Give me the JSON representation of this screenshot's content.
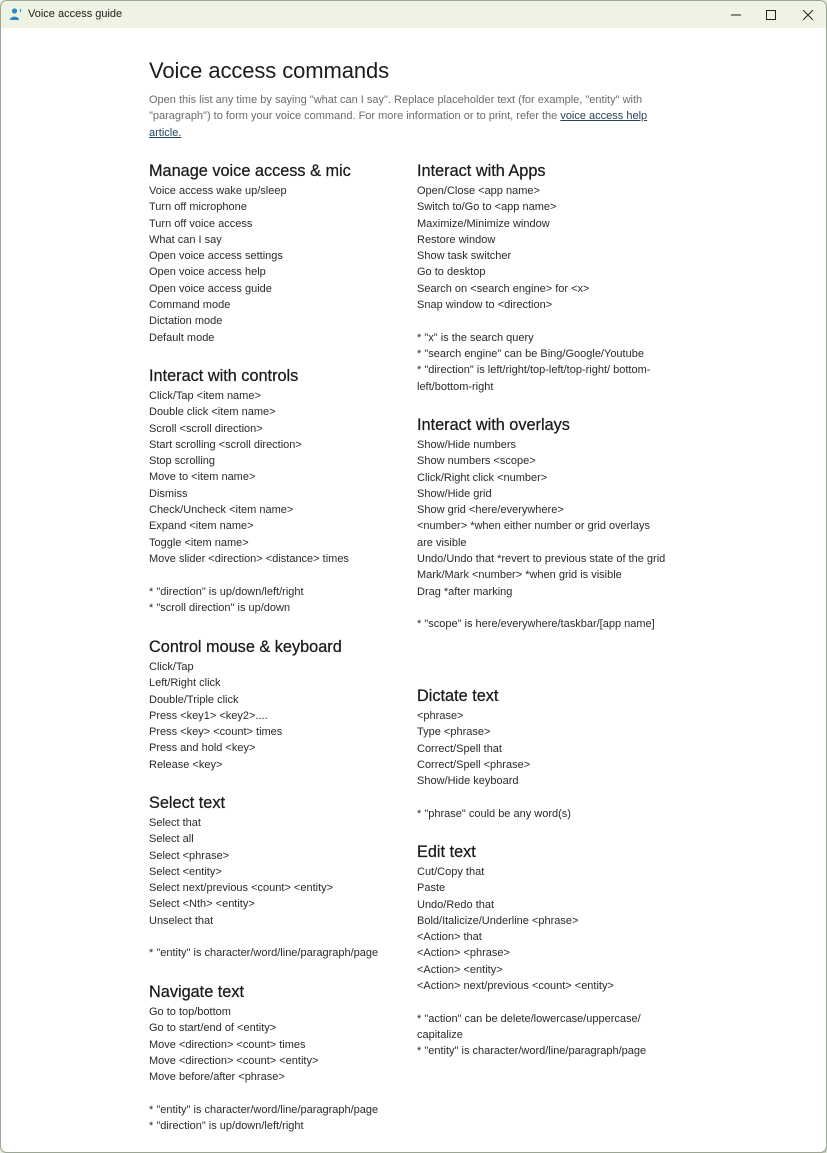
{
  "window": {
    "title": "Voice access guide",
    "controls": {
      "minimize": "minimize",
      "maximize": "maximize",
      "close": "close"
    },
    "accent_color": "#2b88c8"
  },
  "page": {
    "title": "Voice access commands",
    "intro_text": "Open this list any time by saying \"what can I say\". Replace placeholder text (for example, \"entity\" with \"paragraph\") to form your voice command. For more information or to print, refer the ",
    "help_link": "voice access help article."
  },
  "left_column": [
    {
      "heading": "Manage voice access & mic",
      "items": [
        "Voice access wake up/sleep",
        "Turn off microphone",
        "Turn off voice access",
        "What can I say",
        "Open voice access settings",
        "Open voice access help",
        "Open voice access guide",
        "Command mode",
        "Dictation mode",
        "Default mode"
      ],
      "notes": []
    },
    {
      "heading": "Interact with controls",
      "items": [
        "Click/Tap <item name>",
        "Double click <item name>",
        "Scroll <scroll direction>",
        "Start scrolling <scroll direction>",
        "Stop scrolling",
        "Move to <item name>",
        "Dismiss",
        "Check/Uncheck <item name>",
        "Expand <item name>",
        "Toggle <item name>",
        "Move slider <direction> <distance> times"
      ],
      "notes": [
        "* \"direction\" is up/down/left/right",
        "* \"scroll direction\" is up/down"
      ]
    },
    {
      "heading": "Control mouse & keyboard",
      "items": [
        "Click/Tap",
        "Left/Right click",
        "Double/Triple click",
        "Press <key1> <key2>....",
        "Press <key> <count> times",
        "Press and hold <key>",
        "Release <key>"
      ],
      "notes": []
    },
    {
      "heading": "Select text",
      "items": [
        "Select that",
        "Select all",
        "Select <phrase>",
        "Select <entity>",
        "Select next/previous <count> <entity>",
        "Select <Nth> <entity>",
        "Unselect that"
      ],
      "notes": [
        "* \"entity\" is character/word/line/paragraph/page"
      ]
    },
    {
      "heading": "Navigate text",
      "items": [
        "Go to top/bottom",
        "Go to start/end of <entity>",
        "Move <direction> <count> times",
        "Move <direction> <count> <entity>",
        "Move before/after <phrase>"
      ],
      "notes": [
        "* \"entity\" is character/word/line/paragraph/page",
        "* \"direction\" is up/down/left/right"
      ]
    }
  ],
  "right_column": [
    {
      "heading": "Interact with Apps",
      "items": [
        "Open/Close <app name>",
        "Switch to/Go to <app name>",
        "Maximize/Minimize window",
        "Restore window",
        "Show task switcher",
        "Go to desktop",
        "Search on <search engine> for <x>",
        "Snap window to <direction>"
      ],
      "notes": [
        "* \"x\" is the search query",
        "* \"search engine\" can be Bing/Google/Youtube",
        "* \"direction\" is left/right/top-left/top-right/ bottom-left/bottom-right"
      ]
    },
    {
      "heading": "Interact with overlays",
      "items": [
        "Show/Hide numbers",
        "Show numbers <scope>",
        "Click/Right click <number>",
        "Show/Hide grid",
        "Show grid <here/everywhere>",
        "<number>  *when either number or grid overlays are visible",
        "Undo/Undo that *revert to previous state of the grid",
        "Mark/Mark <number> *when grid is visible",
        "Drag *after marking"
      ],
      "notes": [
        "* \"scope\" is here/everywhere/taskbar/[app name]"
      ]
    },
    {
      "heading": "Dictate text",
      "items": [
        "<phrase>",
        "Type <phrase>",
        "Correct/Spell that",
        "Correct/Spell <phrase>",
        "Show/Hide keyboard"
      ],
      "notes": [
        "* \"phrase\" could be any word(s)"
      ]
    },
    {
      "heading": "Edit text",
      "items": [
        "Cut/Copy that",
        "Paste",
        "Undo/Redo that",
        "Bold/Italicize/Underline <phrase>",
        "<Action> that",
        "<Action> <phrase>",
        "<Action> <entity>",
        "<Action> next/previous <count> <entity>"
      ],
      "notes": [
        "* \"action\" can be delete/lowercase/uppercase/ capitalize",
        "* \"entity\" is character/word/line/paragraph/page"
      ]
    }
  ]
}
